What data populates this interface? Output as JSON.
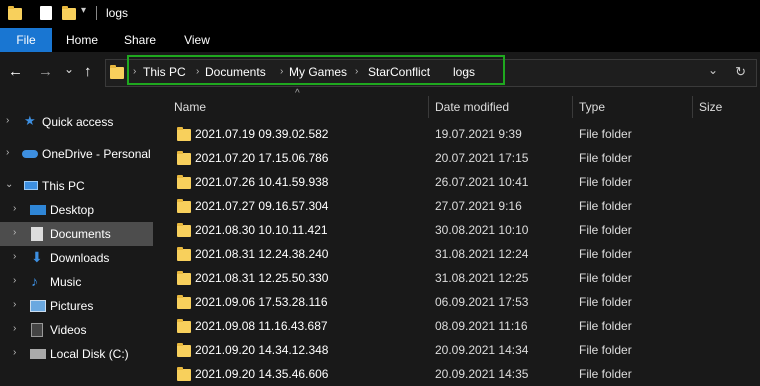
{
  "window": {
    "title": "logs"
  },
  "ribbon": {
    "tabs": [
      "File",
      "Home",
      "Share",
      "View"
    ]
  },
  "nav": {
    "back": "←",
    "forward": "→",
    "recent": "⌄",
    "up": "↑",
    "dropdown": "⌄",
    "refresh": "↻"
  },
  "breadcrumb": [
    "This PC",
    "Documents",
    "My Games",
    "StarConflict",
    "logs"
  ],
  "breadcrumb_highlight_color": "#1fa81f",
  "sidebar": {
    "items": [
      {
        "label": "Quick access",
        "icon": "star-icon"
      },
      {
        "label": "OneDrive - Personal",
        "icon": "cloud-icon"
      },
      {
        "label": "This PC",
        "icon": "computer-icon"
      },
      {
        "label": "Desktop",
        "icon": "desktop-icon"
      },
      {
        "label": "Documents",
        "icon": "documents-icon",
        "selected": true
      },
      {
        "label": "Downloads",
        "icon": "download-icon"
      },
      {
        "label": "Music",
        "icon": "music-icon"
      },
      {
        "label": "Pictures",
        "icon": "pictures-icon"
      },
      {
        "label": "Videos",
        "icon": "videos-icon"
      },
      {
        "label": "Local Disk (C:)",
        "icon": "disk-icon"
      }
    ]
  },
  "columns": {
    "name": "Name",
    "date": "Date modified",
    "type": "Type",
    "size": "Size"
  },
  "files": [
    {
      "name": "2021.07.19 09.39.02.582",
      "date": "19.07.2021 9:39",
      "type": "File folder"
    },
    {
      "name": "2021.07.20 17.15.06.786",
      "date": "20.07.2021 17:15",
      "type": "File folder"
    },
    {
      "name": "2021.07.26 10.41.59.938",
      "date": "26.07.2021 10:41",
      "type": "File folder"
    },
    {
      "name": "2021.07.27 09.16.57.304",
      "date": "27.07.2021 9:16",
      "type": "File folder"
    },
    {
      "name": "2021.08.30 10.10.11.421",
      "date": "30.08.2021 10:10",
      "type": "File folder"
    },
    {
      "name": "2021.08.31 12.24.38.240",
      "date": "31.08.2021 12:24",
      "type": "File folder"
    },
    {
      "name": "2021.08.31 12.25.50.330",
      "date": "31.08.2021 12:25",
      "type": "File folder"
    },
    {
      "name": "2021.09.06 17.53.28.116",
      "date": "06.09.2021 17:53",
      "type": "File folder"
    },
    {
      "name": "2021.09.08 11.16.43.687",
      "date": "08.09.2021 11:16",
      "type": "File folder"
    },
    {
      "name": "2021.09.20 14.34.12.348",
      "date": "20.09.2021 14:34",
      "type": "File folder"
    },
    {
      "name": "2021.09.20 14.35.46.606",
      "date": "20.09.2021 14:35",
      "type": "File folder"
    }
  ]
}
